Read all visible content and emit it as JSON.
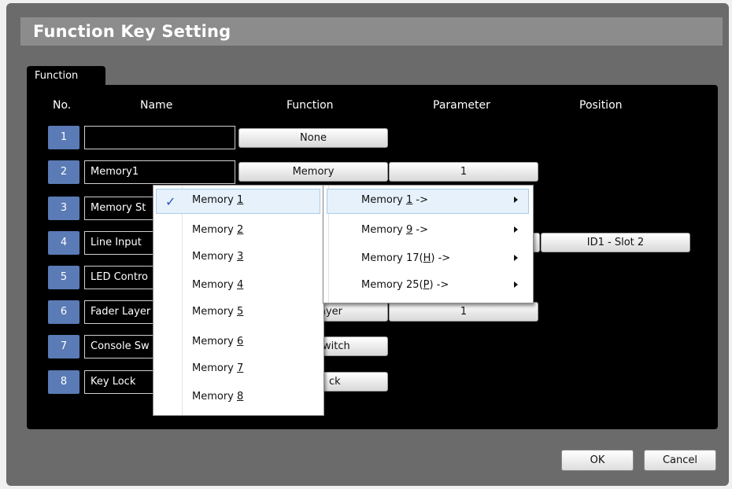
{
  "window": {
    "title": "Function Key Setting"
  },
  "tabs": [
    {
      "label": "Function"
    }
  ],
  "columns": {
    "no": "No.",
    "name": "Name",
    "function": "Function",
    "parameter": "Parameter",
    "position": "Position"
  },
  "rows": [
    {
      "no": "1",
      "name": "",
      "function": "None",
      "parameter": "",
      "position": ""
    },
    {
      "no": "2",
      "name": "Memory1",
      "function": "Memory",
      "parameter": "1",
      "position": ""
    },
    {
      "no": "3",
      "name": "Memory St",
      "function": "",
      "parameter": "",
      "position": ""
    },
    {
      "no": "4",
      "name": "Line Input",
      "function": "",
      "parameter": "",
      "position": "ID1 - Slot 2"
    },
    {
      "no": "5",
      "name": "LED Contro",
      "function": "",
      "parameter": "",
      "position": ""
    },
    {
      "no": "6",
      "name": "Fader Layer",
      "function": "ayer",
      "parameter": "1",
      "position": ""
    },
    {
      "no": "7",
      "name": "Console Sw",
      "function": "witch",
      "parameter": "",
      "position": ""
    },
    {
      "no": "8",
      "name": "Key Lock",
      "function": "ck",
      "parameter": "",
      "position": ""
    }
  ],
  "memory_menu": {
    "items": [
      {
        "prefix": "Memory ",
        "key": "1",
        "checked": true,
        "highlighted": true
      },
      {
        "prefix": "Memory ",
        "key": "2"
      },
      {
        "prefix": "Memory ",
        "key": "3"
      },
      {
        "prefix": "Memory ",
        "key": "4"
      },
      {
        "prefix": "Memory ",
        "key": "5"
      },
      {
        "prefix": "Memory ",
        "key": "6"
      },
      {
        "prefix": "Memory ",
        "key": "7"
      },
      {
        "prefix": "Memory ",
        "key": "8"
      }
    ],
    "check_glyph": "✓"
  },
  "group_menu": {
    "items": [
      {
        "prefix": "Memory ",
        "key": "1",
        "suffix": " ->",
        "highlighted": true
      },
      {
        "prefix": "Memory ",
        "key": "9",
        "suffix": " ->"
      },
      {
        "prefix": "Memory 17(",
        "key": "H",
        "suffix": ") ->"
      },
      {
        "prefix": "Memory 25(",
        "key": "P",
        "suffix": ") ->"
      }
    ]
  },
  "footer": {
    "ok": "OK",
    "cancel": "Cancel"
  },
  "colors": {
    "number_badge": "#5a7bb5",
    "menu_highlight": "#e6f1fb",
    "check": "#2a52be"
  }
}
